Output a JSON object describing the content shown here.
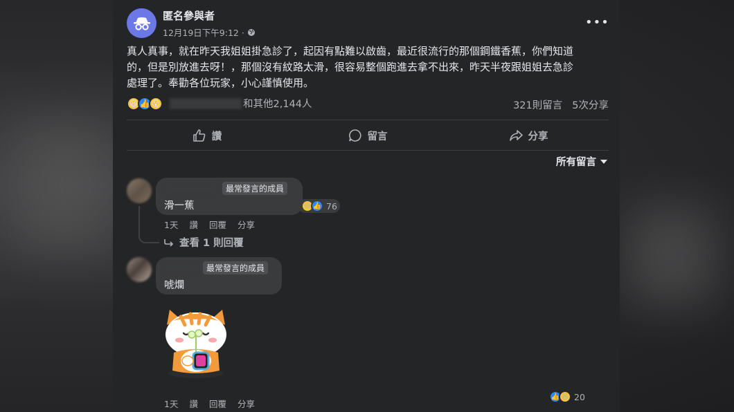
{
  "post": {
    "author": "匿名參與者",
    "timestamp": "12月19日下午9:12 ·",
    "audience_icon": "globe-icon",
    "more_label": "•••",
    "body_line1": "真人真事，就在昨天我姐姐掛急診了，起因有點難以啟齒，最近很流行的那個鋼鐵香蕉，你們知道",
    "body_line2": "的，但是別放進去呀！，那個沒有紋路太滑，很容易整個跑進去拿不出來，昨天半夜跟姐姐去急診",
    "body_line3": "處理了。奉勸各位玩家，小心謹慎使用。",
    "reactions_text": "和其他2,144人",
    "comment_count": "321則留言",
    "share_count": "5次分享"
  },
  "actions": {
    "like": "讚",
    "comment": "留言",
    "share": "分享"
  },
  "sort_label": "所有留言",
  "comments": [
    {
      "badge": "最常發言的成員",
      "text": "滑一蕉",
      "reaction_count": "76",
      "age": "1天",
      "like": "讚",
      "reply": "回覆",
      "share": "分享",
      "view_replies": "查看 1 則回覆"
    },
    {
      "badge": "最常發言的成員",
      "text": "唬爛",
      "reaction_count": "20",
      "age": "1天",
      "like": "讚",
      "reply": "回覆",
      "share": "分享"
    }
  ],
  "colors": {
    "post_bg": "#242526",
    "bubble_bg": "#3a3b3c",
    "text_primary": "#e4e6eb",
    "text_secondary": "#b0b3b8",
    "like_blue": "#2d88ff",
    "haha_yellow": "#f7c443",
    "avatar_purple": "#6c78e6"
  }
}
